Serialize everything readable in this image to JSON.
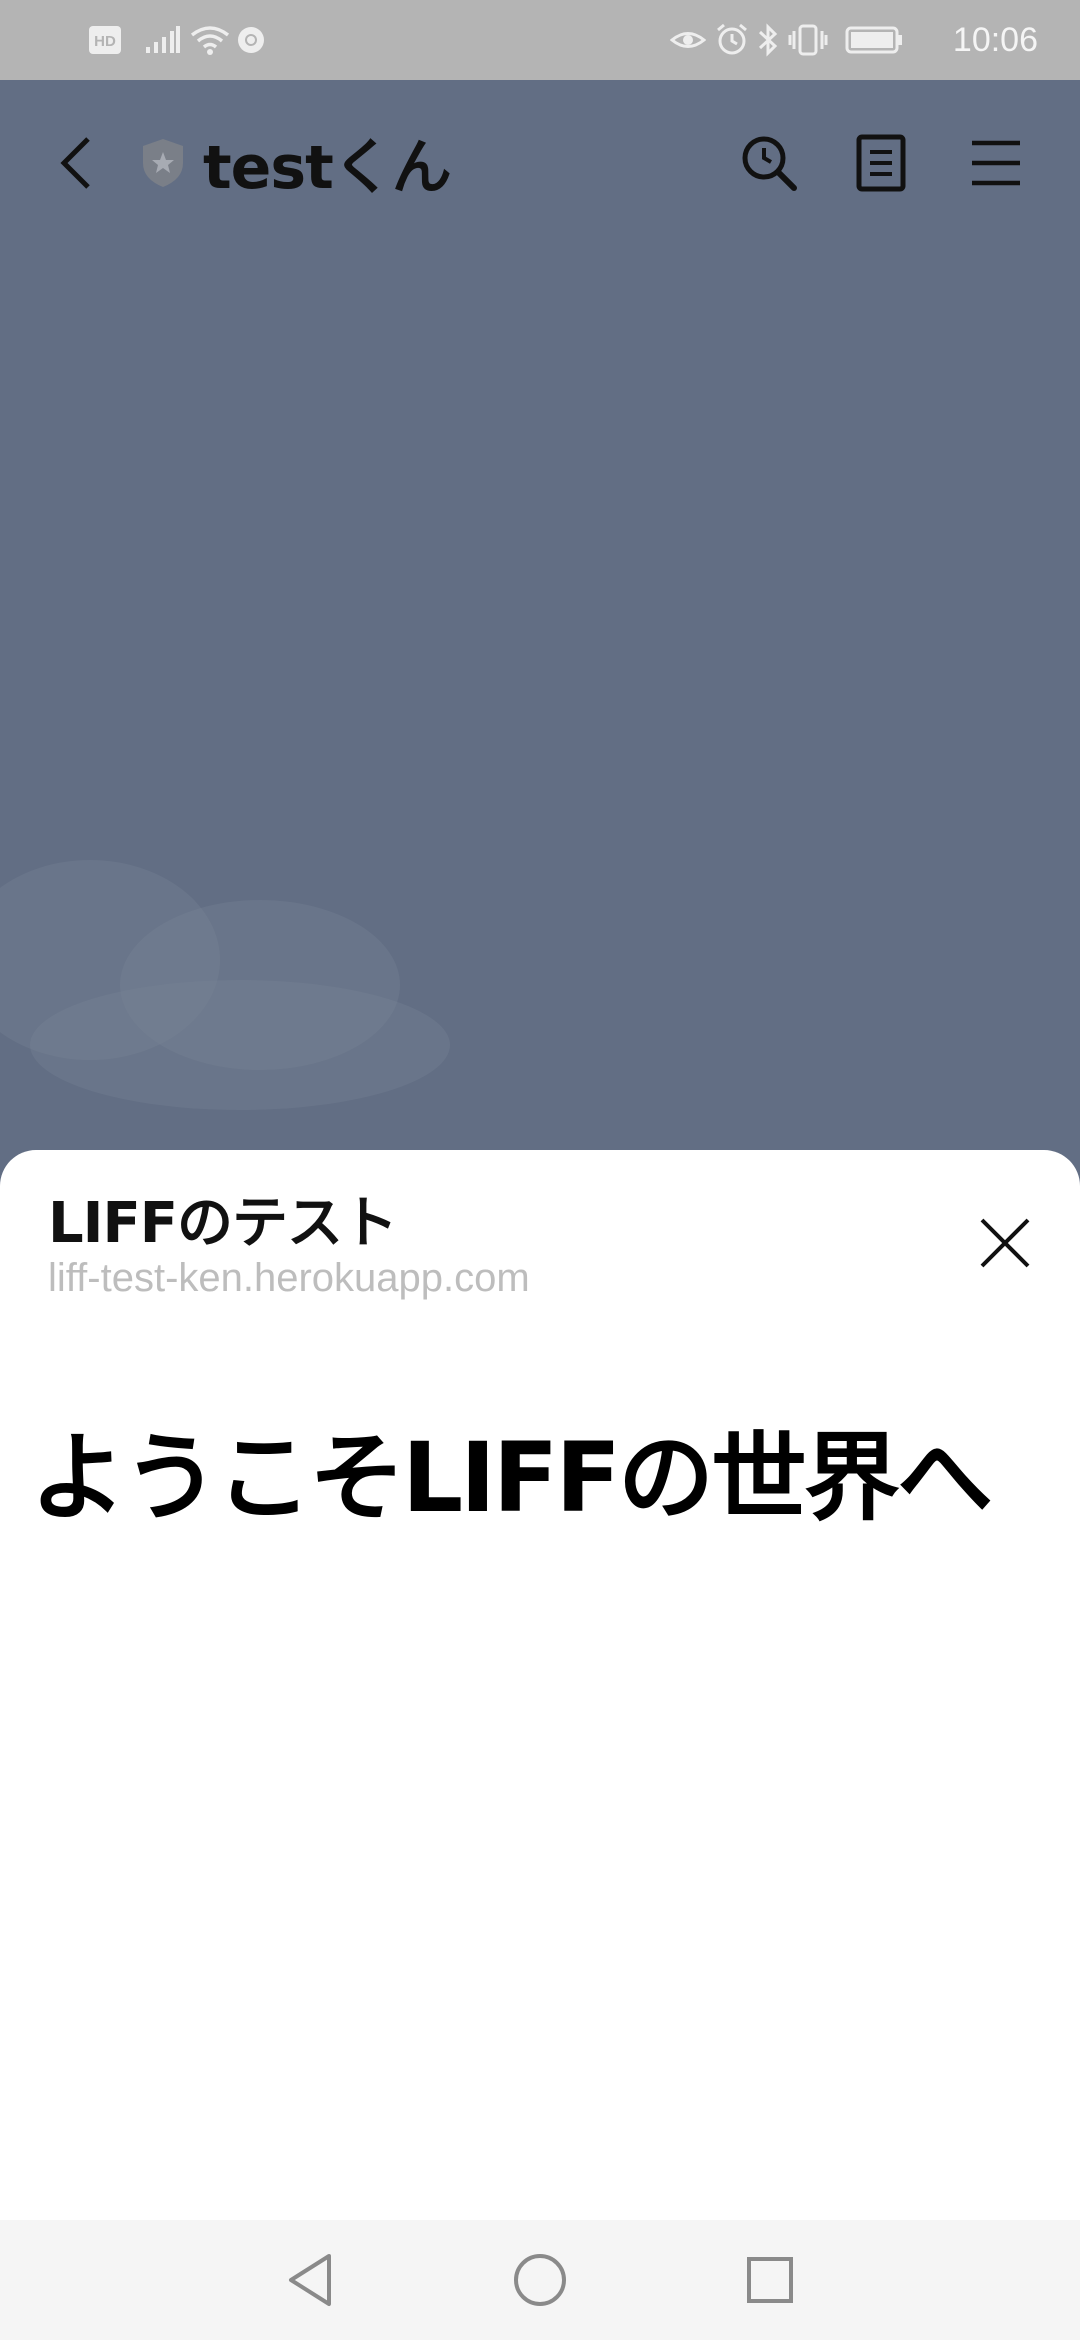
{
  "status_bar": {
    "time": "10:06",
    "left_icons": [
      "hd-icon",
      "signal-icon",
      "wifi-icon",
      "chrome-icon"
    ],
    "right_icons": [
      "eye-icon",
      "alarm-icon",
      "bluetooth-icon",
      "vibrate-icon",
      "battery-icon"
    ],
    "hd_label": "HD"
  },
  "chat_header": {
    "title": "testくん",
    "icons": [
      "back-icon",
      "shield-star-icon",
      "search-icon",
      "note-icon",
      "menu-icon"
    ]
  },
  "liff_sheet": {
    "title": "LIFFのテスト",
    "url": "liff-test-ken.herokuapp.com",
    "close_icon": "close-icon"
  },
  "content": {
    "heading": "ようこそLIFFの世界へ"
  },
  "nav_bar": {
    "icons": [
      "back-triangle-icon",
      "home-circle-icon",
      "recents-square-icon"
    ]
  },
  "colors": {
    "chat_background": "#626e84",
    "status_bar": "#b4b4b4",
    "sheet": "#ffffff",
    "url_text": "#bdbdbd",
    "nav_bar": "#f5f5f5"
  }
}
